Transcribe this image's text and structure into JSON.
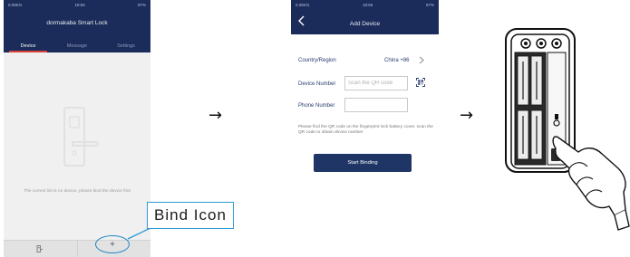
{
  "screen1": {
    "status": {
      "left": "0.08K/s",
      "time": "18:56",
      "right": "97%"
    },
    "app_title": "dormakaba Smart Lock",
    "tabs": [
      "Device",
      "Message",
      "Settings"
    ],
    "active_tab": "Device",
    "empty_text": "The current list is no device, please bind the device first",
    "add_label": "+",
    "callout": "Bind Icon"
  },
  "arrows": [
    "→",
    "→"
  ],
  "screen2": {
    "status": {
      "left": "0.08K/s",
      "time": "18:56",
      "right": "97%"
    },
    "title": "Add Device",
    "country_label": "Country/Region",
    "country_value": "China +86",
    "device_number_label": "Device Number",
    "device_number_placeholder": "Scan the QR code",
    "phone_number_label": "Phone Number",
    "phone_number_value": "",
    "hint": "Please find the QR code on the fingerprint lock battery cover, scan the QR code to obtain device number",
    "submit_label": "Start Binding"
  },
  "colors": {
    "navbar": "#1c2c5a",
    "accent_red": "#d9453a",
    "callout_blue": "#2d9ad6",
    "button": "#1e3566"
  },
  "icons": {
    "back": "chevron-left-icon",
    "qr": "qr-scan-icon",
    "country_chevron": "chevron-right-icon",
    "lock_placeholder": "door-lock-icon",
    "device_tab": "device-tab-icon"
  }
}
